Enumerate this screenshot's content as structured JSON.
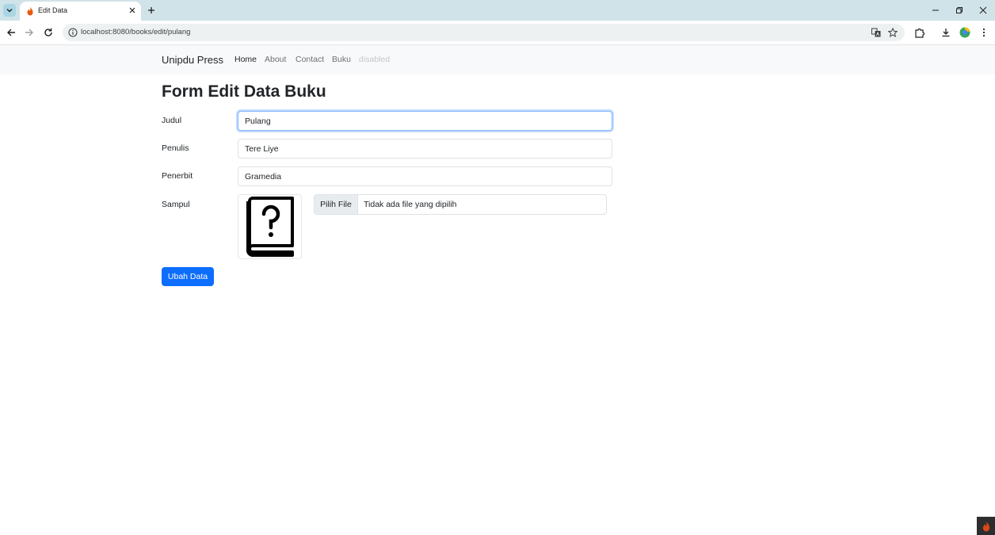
{
  "browser": {
    "tab_title": "Edit Data",
    "url": "localhost:8080/books/edit/pulang"
  },
  "navbar": {
    "brand": "Unipdu Press",
    "links": [
      {
        "label": "Home",
        "state": "active"
      },
      {
        "label": "About",
        "state": "normal"
      },
      {
        "label": "Contact",
        "state": "normal"
      },
      {
        "label": "Buku",
        "state": "normal"
      },
      {
        "label": "disabled",
        "state": "disabled"
      }
    ]
  },
  "form": {
    "title": "Form Edit Data Buku",
    "fields": {
      "judul": {
        "label": "Judul",
        "value": "Pulang"
      },
      "penulis": {
        "label": "Penulis",
        "value": "Tere Liye"
      },
      "penerbit": {
        "label": "Penerbit",
        "value": "Gramedia"
      },
      "sampul": {
        "label": "Sampul",
        "file_button": "Pilih File",
        "file_status": "Tidak ada file yang dipilih",
        "preview_icon": "unknown-book-icon"
      }
    },
    "submit_label": "Ubah Data"
  },
  "colors": {
    "primary": "#0d6efd",
    "navbar_bg": "#f8f9fa",
    "tabbar_bg": "#cfe3e8"
  }
}
